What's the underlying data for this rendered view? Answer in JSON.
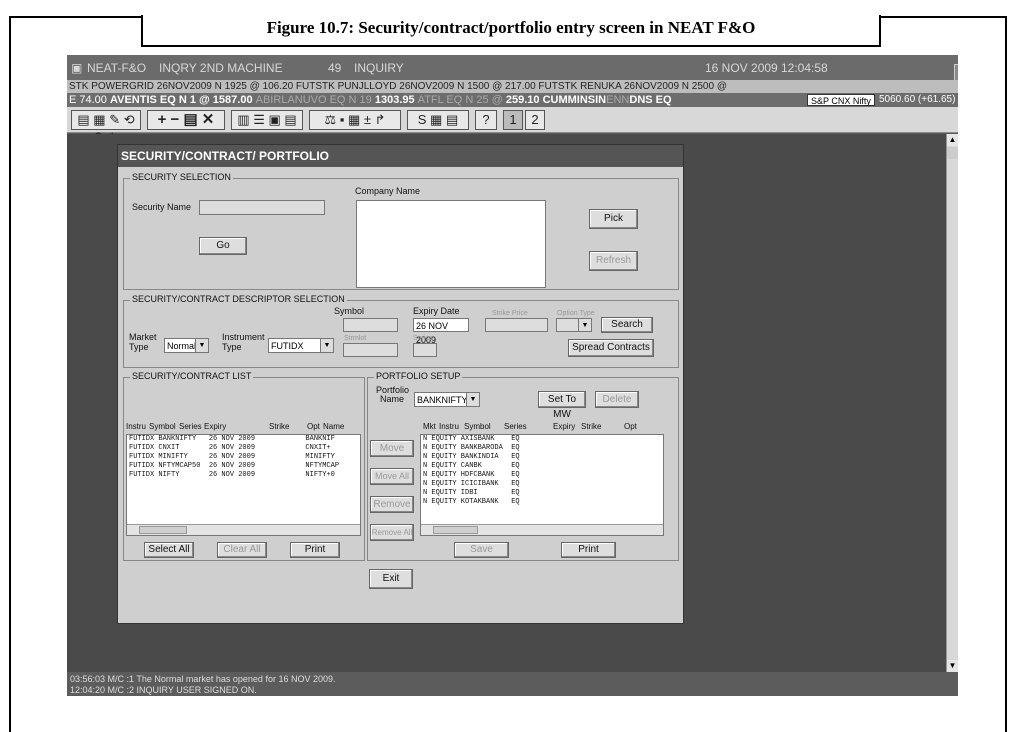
{
  "figure_caption": "Figure 10.7: Security/contract/portfolio entry screen in NEAT F&O",
  "app": {
    "title": "NEAT-F&O",
    "machine": "INQRY 2ND MACHINE",
    "number": "49",
    "mode": "INQUIRY",
    "date": "16 NOV 2009",
    "time": "12:04:58"
  },
  "ticker1": "STK POWERGRID 26NOV2009 N 1925 @   106.20 FUTSTK PUNJLLOYD 26NOV2009 N 1500 @   217.00 FUTSTK RENUKA 26NOV2009 N 2500 @",
  "ticker2": {
    "part1": "E  74.00 ",
    "part2": "AVENTIS EQ N 1 @   1587.00 ",
    "part3": "ABIRLANUVO EQ N 19   ",
    "part4": "1303.95 ",
    "part5": "ATFL EQ N 25 @   ",
    "part6": "259.10 CUMMINSIN",
    "part7": "ENN",
    "part8": "DNS EQ",
    "nifty_label": "S&P CNX Nifty",
    "nifty_value": "5060.60 (+61.65)"
  },
  "toolbar": {
    "page1": "1",
    "page2": "2"
  },
  "dialog": {
    "title": "SECURITY/CONTRACT/ PORTFOLIO",
    "security_selection": {
      "group_label": "SECURITY SELECTION",
      "company_name_label": "Company Name",
      "security_name_label": "Security Name",
      "security_name_value": "",
      "go": "Go",
      "pick": "Pick",
      "refresh": "Refresh"
    },
    "descriptor": {
      "group_label": "SECURITY/CONTRACT DESCRIPTOR SELECTION",
      "market_type_label": "Market Type",
      "market_type_value": "Normal",
      "instrument_type_label": "Instrument Type",
      "instrument_type_value": "FUTIDX",
      "symbol_label": "Symbol",
      "symbol_value": "",
      "expiry_date_label": "Expiry Date",
      "expiry_date_value": "26 NOV 2009",
      "strike_price_label": "Strike Price",
      "option_type_label": "Option Type",
      "search": "Search",
      "spread_contracts": "Spread Contracts",
      "lot_label": "Strmlot",
      "series_label": "Series"
    },
    "contract_list": {
      "group_label": "SECURITY/CONTRACT LIST",
      "headers": [
        "Instru",
        "Symbol",
        "Series",
        "Expiry",
        "Strike",
        "Opt",
        "Name"
      ],
      "rows": [
        "FUTIDX BANKNIFTY   26 NOV 2009            BANKNIF",
        "FUTIDX CNXIT       26 NOV 2009            CNXIT+",
        "FUTIDX MINIFTY     26 NOV 2009            MINIFTY",
        "FUTIDX NFTYMCAP50  26 NOV 2009            NFTYMCAP",
        "FUTIDX NIFTY       26 NOV 2009            NIFTY+0"
      ],
      "select_all": "Select All",
      "clear_all": "Clear All",
      "print": "Print"
    },
    "portfolio": {
      "group_label": "PORTFOLIO SETUP",
      "portfolio_name_label": "Portfolio Name",
      "portfolio_name_value": "BANKNIFTY",
      "set_to_mw": "Set To MW",
      "delete": "Delete",
      "headers": [
        "Mkt",
        "Instru",
        "Symbol",
        "Series",
        "Expiry",
        "Strike",
        "Opt"
      ],
      "rows": [
        "N EQUITY AXISBANK    EQ",
        "N EQUITY BANKBARODA  EQ",
        "N EQUITY BANKINDIA   EQ",
        "N EQUITY CANBK       EQ",
        "N EQUITY HDFCBANK    EQ",
        "N EQUITY ICICIBANK   EQ",
        "N EQUITY IDBI        EQ",
        "N EQUITY KOTAKBANK   EQ"
      ],
      "move": "Move",
      "move_all": "Move All",
      "remove": "Remove",
      "remove_all": "Remove All",
      "save": "Save",
      "print": "Print"
    },
    "exit": "Exit"
  },
  "status": {
    "line1": "03:56:03   M/C :1  The Normal market has opened for 16 NOV 2009.",
    "line2": "12:04:20   M/C :2  INQUIRY USER SIGNED ON."
  }
}
